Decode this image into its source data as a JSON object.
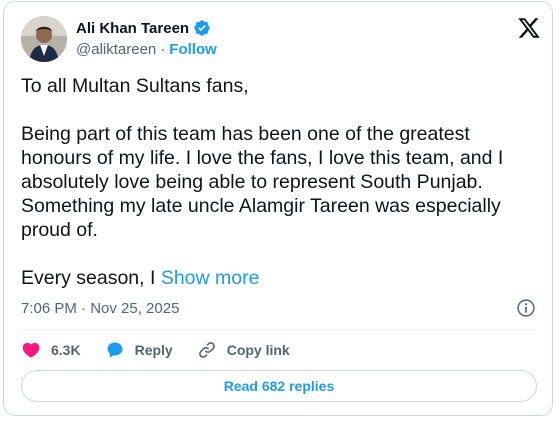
{
  "author": {
    "name": "Ali Khan Tareen",
    "handle": "@aliktareen",
    "separator": "·",
    "follow_label": "Follow",
    "verified_color": "#1d9bf0"
  },
  "tweet": {
    "line1": "To all Multan Sultans fans,",
    "para2_line1": "Being part of this team has been one of the greatest",
    "para2_line2": "honours of my life. I love the fans, I love this team, and I",
    "para2_line3": "absolutely love being able to represent South Punjab.",
    "para2_line4": "Something my late uncle Alamgir Tareen was especially",
    "para2_line5": "proud of.",
    "para3_start": "Every season, I ",
    "show_more": "Show more"
  },
  "timestamp": "7:06 PM · Nov 25, 2025",
  "actions": {
    "likes": "6.3K",
    "reply_label": "Reply",
    "copy_link_label": "Copy link"
  },
  "read_replies_label": "Read 682 replies",
  "colors": {
    "accent": "#1d9bf0",
    "like": "#f91880",
    "text": "#0f1419",
    "muted": "#536471"
  },
  "icons": {
    "brand": "x-logo-icon",
    "verified": "verified-badge-icon",
    "info": "info-icon",
    "like": "heart-icon",
    "reply": "speech-bubble-icon",
    "copy_link": "link-icon"
  }
}
